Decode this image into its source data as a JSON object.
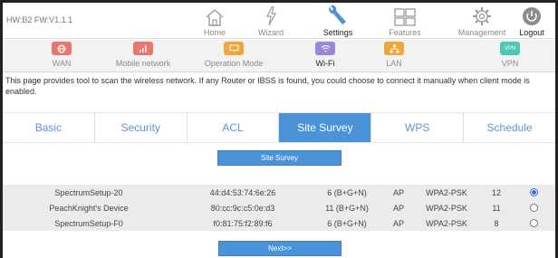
{
  "header": {
    "firmware": "HW:B2 FW:V1.1.1",
    "nav": [
      {
        "label": "Home",
        "icon": "home-icon"
      },
      {
        "label": "Wizard",
        "icon": "wizard-icon"
      },
      {
        "label": "Settings",
        "icon": "wrench-icon"
      },
      {
        "label": "Features",
        "icon": "grid-icon"
      },
      {
        "label": "Management",
        "icon": "gear-icon"
      },
      {
        "label": "Logout",
        "icon": "logout-icon"
      }
    ],
    "active": "Settings"
  },
  "subnav": {
    "items": [
      {
        "label": "WAN",
        "color": "#e8766e",
        "icon": "globe-icon"
      },
      {
        "label": "Mobile network",
        "color": "#e8766e",
        "icon": "signal-icon"
      },
      {
        "label": "Operation Mode",
        "color": "#f0a63a",
        "icon": "monitor-icon"
      },
      {
        "label": "Wi-Fi",
        "color": "#9a88d6",
        "icon": "wifi-icon"
      },
      {
        "label": "LAN",
        "color": "#f0a63a",
        "icon": "lan-icon"
      },
      {
        "label": "VPN",
        "color": "#4cc9b4",
        "icon": "vpn-icon",
        "tile_text": "VPN"
      }
    ],
    "active": "Wi-Fi"
  },
  "description": "This page provides tool to scan the wireless network. If any Router or IBSS is found, you could choose to connect it manually when client mode is enabled.",
  "tabs": {
    "items": [
      "Basic",
      "Security",
      "ACL",
      "Site Survey",
      "WPS",
      "Schedule"
    ],
    "active": "Site Survey"
  },
  "site_survey_button": "Site Survey",
  "networks": [
    {
      "ssid": "SpectrumSetup-20",
      "bssid": "44:d4:53:74:6e:26",
      "channel": "6 (B+G+N)",
      "type": "AP",
      "encryption": "WPA2-PSK",
      "signal": "12",
      "selected": true
    },
    {
      "ssid": "PeachKnight's Device",
      "bssid": "80:cc:9c:c5:0e:d3",
      "channel": "11 (B+G+N)",
      "type": "AP",
      "encryption": "WPA2-PSK",
      "signal": "11",
      "selected": false
    },
    {
      "ssid": "SpectrumSetup-F0",
      "bssid": "f0:81:75:f2:89:f6",
      "channel": "6 (B+G+N)",
      "type": "AP",
      "encryption": "WPA2-PSK",
      "signal": "8",
      "selected": false
    }
  ],
  "next_button": "Next>>"
}
